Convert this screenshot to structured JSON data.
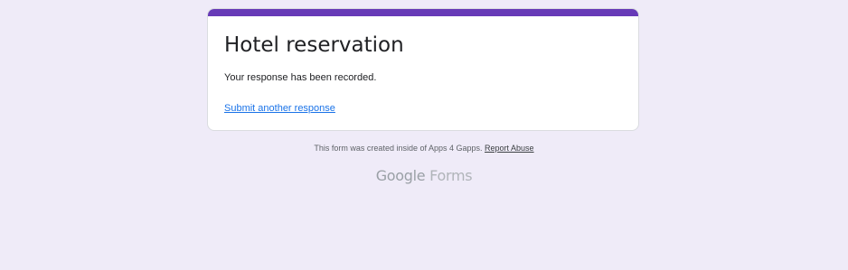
{
  "form": {
    "title": "Hotel reservation",
    "confirmation_message": "Your response has been recorded.",
    "submit_another_label": "Submit another response"
  },
  "footer": {
    "note_text": "This form was created inside of Apps 4 Gapps.",
    "report_abuse_label": "Report Abuse",
    "brand_google": "Google",
    "brand_forms": "Forms"
  },
  "colors": {
    "accent": "#673ab7",
    "background": "#efebf8",
    "link": "#1a73e8"
  }
}
